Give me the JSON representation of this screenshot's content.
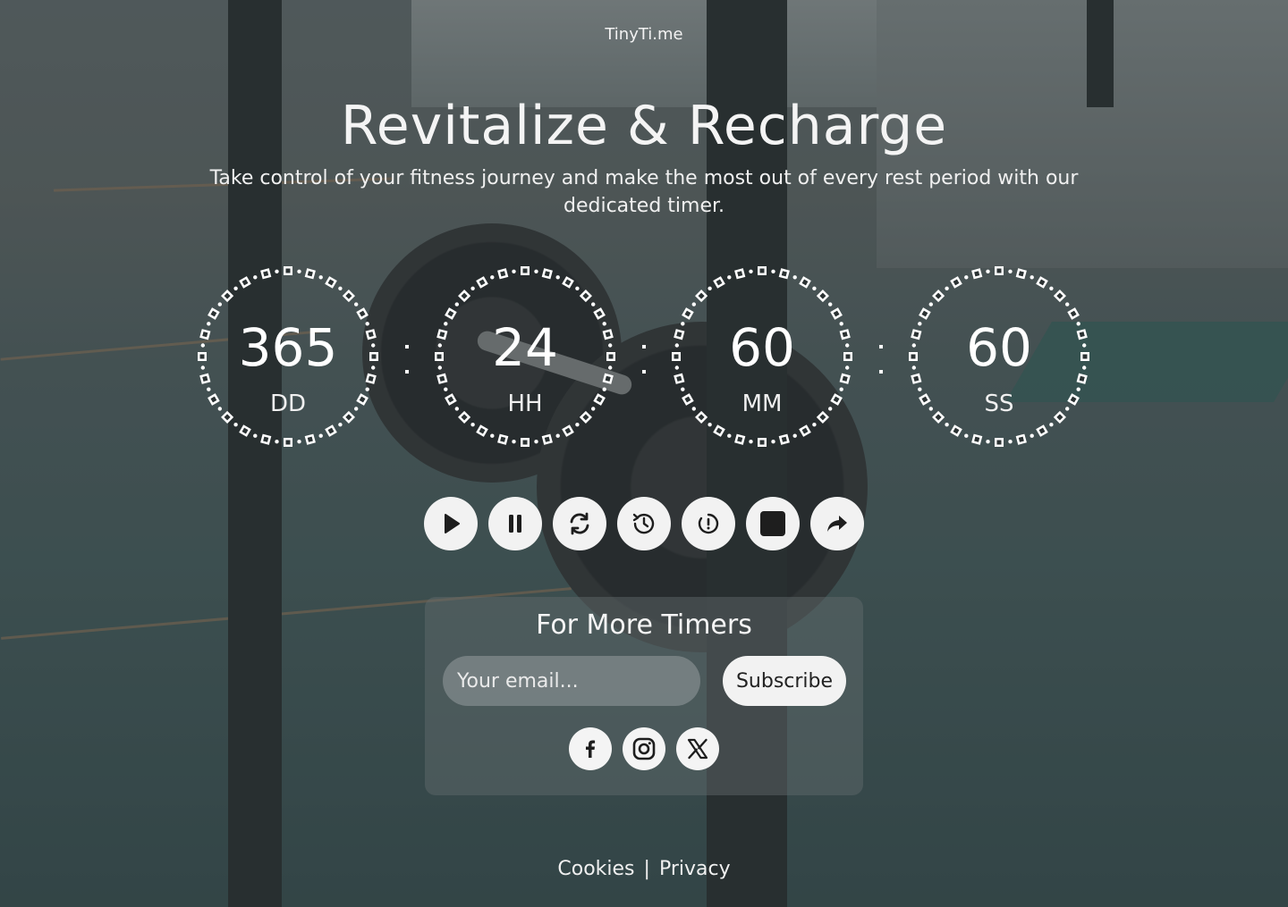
{
  "brand": "TinyTi.me",
  "headline": "Revitalize & Recharge",
  "subtitle": "Take control of your fitness journey and make the most out of every rest period with our dedicated timer.",
  "timer": {
    "days": {
      "value": "365",
      "label": "DD"
    },
    "hours": {
      "value": "24",
      "label": "HH"
    },
    "minutes": {
      "value": "60",
      "label": "MM"
    },
    "seconds": {
      "value": "60",
      "label": "SS"
    }
  },
  "controls": [
    {
      "icon": "play-icon"
    },
    {
      "icon": "pause-icon"
    },
    {
      "icon": "refresh-icon"
    },
    {
      "icon": "history-icon"
    },
    {
      "icon": "timer-alert-icon"
    },
    {
      "icon": "stop-icon"
    },
    {
      "icon": "share-icon"
    }
  ],
  "subscribe": {
    "title": "For More Timers",
    "placeholder": "Your email...",
    "button": "Subscribe"
  },
  "social": [
    "facebook-icon",
    "instagram-icon",
    "x-icon"
  ],
  "footer": {
    "cookies": "Cookies",
    "separator": "|",
    "privacy": "Privacy"
  },
  "colors": {
    "button_bg": "#f2f2f2",
    "icon": "#1e1e1e",
    "text": "#ffffff"
  }
}
